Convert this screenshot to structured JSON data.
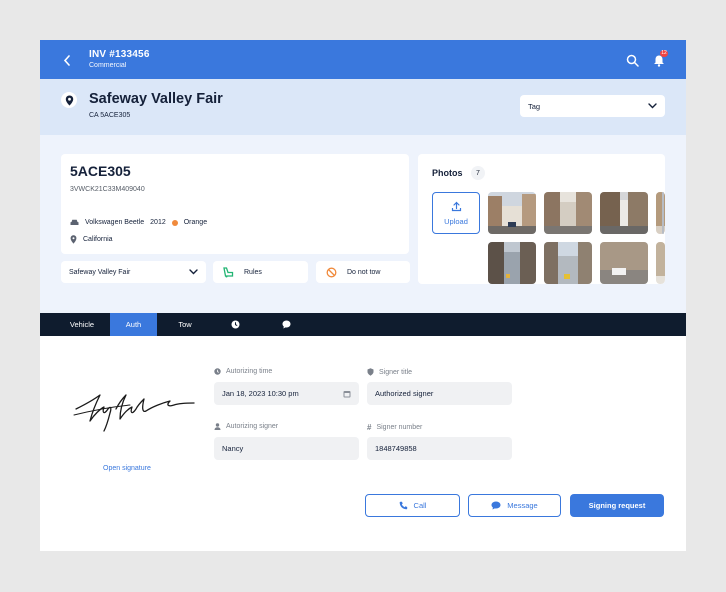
{
  "topbar": {
    "invoice": "INV #133456",
    "category": "Commercial",
    "notification_count": "12"
  },
  "location": {
    "name": "Safeway Valley Fair",
    "plate_ref": "CA 5ACE305"
  },
  "tag_select": {
    "label": "Tag"
  },
  "vehicle": {
    "plate": "5ACE305",
    "vin": "3VWCK21C33M409040",
    "make_model": "Volkswagen Beetle",
    "year": "2012",
    "color_name": "Orange",
    "color_hex": "#f08a3c",
    "state": "California"
  },
  "actions": {
    "lot_select": "Safeway Valley Fair",
    "rules": "Rules",
    "do_not_tow": "Do not tow"
  },
  "photos": {
    "title": "Photos",
    "count": "7",
    "upload_label": "Upload"
  },
  "tabs": [
    {
      "label": "Vehicle",
      "active": false
    },
    {
      "label": "Auth",
      "active": true
    },
    {
      "label": "Tow",
      "active": false
    },
    {
      "label": "",
      "icon": "clock-icon"
    },
    {
      "label": "",
      "icon": "chat-icon"
    }
  ],
  "auth": {
    "open_signature": "Open signature",
    "authorizing_time_label": "Autorizing time",
    "authorizing_time_value": "Jan 18, 2023 10:30 pm",
    "signer_title_label": "Signer title",
    "signer_title_value": "Authorized signer",
    "authorizing_signer_label": "Autorizing signer",
    "authorizing_signer_value": "Nancy",
    "signer_number_label": "Signer number",
    "signer_number_value": "1848749858"
  },
  "buttons": {
    "call": "Call",
    "message": "Message",
    "signing_request": "Signing request"
  },
  "colors": {
    "accent": "#3a78dd",
    "header_bg": "#dbe7f8",
    "tabbar_bg": "#0f1c2e",
    "page_bg": "#e8e8e8"
  }
}
